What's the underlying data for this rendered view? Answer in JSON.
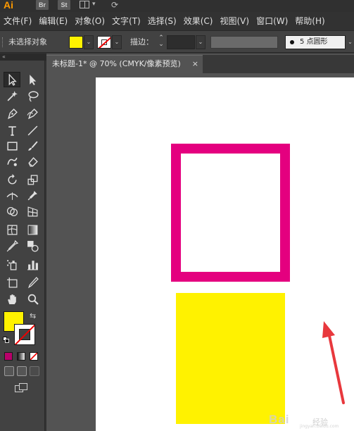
{
  "app": {
    "logo": "Ai",
    "bridge": "Br",
    "stock": "St"
  },
  "menu": [
    "文件(F)",
    "编辑(E)",
    "对象(O)",
    "文字(T)",
    "选择(S)",
    "效果(C)",
    "视图(V)",
    "窗口(W)",
    "帮助(H)"
  ],
  "control_bar": {
    "selection_status": "未选择对象",
    "stroke_label": "描边：",
    "brush_label": "5 点圆形",
    "fill_color": "#fff200",
    "stroke_color": "none"
  },
  "document": {
    "tab_title": "未标题-1* @ 70% (CMYK/像素预览)",
    "close_glyph": "×"
  },
  "artwork": {
    "rect_stroke_color": "#e4007f",
    "rect_fill_color": "#fff200",
    "arrow_color": "#e8383d"
  },
  "watermark": {
    "logo_text": "Bai",
    "sub_text": "经验",
    "url": "jingyan.baidu.com"
  }
}
